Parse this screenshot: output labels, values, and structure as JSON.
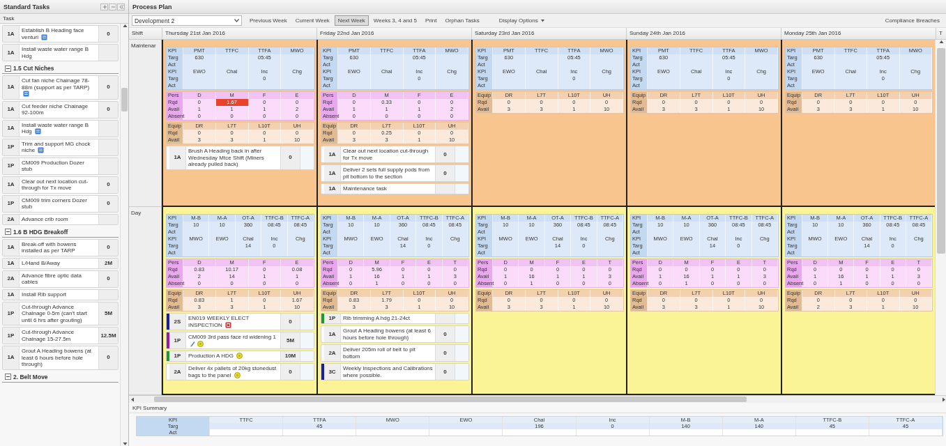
{
  "sidebar": {
    "title": "Standard Tasks",
    "column": "Task",
    "items": [
      {
        "kind": "task",
        "code": "1A",
        "name": "Establish B Heading face venturi",
        "qty": "0",
        "icons": [
          {
            "kind": "note"
          }
        ]
      },
      {
        "kind": "task",
        "code": "1A",
        "name": "Install waste water range B Hdg"
      },
      {
        "kind": "group",
        "title": "1.5 Cut Niches",
        "expanded": true
      },
      {
        "kind": "task",
        "code": "1A",
        "name": "Cut fan niche Chainage 78-88m (support as per TARP)",
        "qty": "0",
        "icons": [
          {
            "kind": "note"
          }
        ]
      },
      {
        "kind": "task",
        "code": "1A",
        "name": "Cut feeder niche Chainage 92-100m",
        "qty": "0"
      },
      {
        "kind": "task",
        "code": "1A",
        "name": "Install waste water range B Hdg",
        "icons": [
          {
            "kind": "note"
          }
        ]
      },
      {
        "kind": "task",
        "code": "1P",
        "name": "Trim and support MG chock niche",
        "icons": [
          {
            "kind": "note"
          }
        ]
      },
      {
        "kind": "task",
        "code": "1P",
        "name": "CM009 Production Dozer stub"
      },
      {
        "kind": "task",
        "code": "1A",
        "name": "Clear out next location cut-through for Tx move",
        "qty": "0"
      },
      {
        "kind": "task",
        "code": "1P",
        "name": "CM009 trim corners Dozer stub",
        "qty": "0"
      },
      {
        "kind": "task",
        "code": "2A",
        "name": "Advance crib room"
      },
      {
        "kind": "group",
        "title": "1.6 B HDG Breakoff",
        "expanded": true
      },
      {
        "kind": "task",
        "code": "1A",
        "name": "Break-off with bowens installed as per TARP",
        "qty": "0"
      },
      {
        "kind": "task",
        "code": "1A",
        "name": "L/Hand B/Away",
        "qty": "2M"
      },
      {
        "kind": "task",
        "code": "2A",
        "name": "Advance fibre optic data cables",
        "qty": "0"
      },
      {
        "kind": "task",
        "code": "1A",
        "name": "Install Rib support"
      },
      {
        "kind": "task",
        "code": "1P",
        "name": "Cut-through Advance Chainage 0-5m (can't start until 6 hrs after grouting)",
        "qty": "5M"
      },
      {
        "kind": "task",
        "code": "1P",
        "name": "Cut-through Advance Chainage 15-27.5m",
        "qty": "12.5M"
      },
      {
        "kind": "task",
        "code": "1A",
        "name": "Grout A Heading bowens (at least 6 hours before hole through)",
        "qty": "0"
      },
      {
        "kind": "group",
        "title": "2. Belt Move",
        "expanded": true
      }
    ]
  },
  "plan": {
    "title": "Process Plan",
    "unit": "Development 2",
    "toolbar": [
      {
        "label": "Previous Week",
        "selected": false
      },
      {
        "label": "Current Week",
        "selected": false
      },
      {
        "label": "Next Week",
        "selected": true
      },
      {
        "label": "Weeks 3, 4 and 5",
        "selected": false
      },
      {
        "label": "Print",
        "selected": false
      },
      {
        "label": "Orphan Tasks",
        "selected": false
      }
    ],
    "display_options": "Display Options",
    "compliance": "Compliance Breaches",
    "shift_header": "Shift",
    "days": [
      "Thursday 21st Jan 2016",
      "Friday 22nd Jan 2016",
      "Saturday 23rd Jan 2016",
      "Sunday 24th Jan 2016",
      "Monday 25th Jan 2016",
      "T"
    ],
    "shifts": [
      {
        "name": "Maintenar",
        "kind": "maintenance",
        "cells": [
          {
            "blocks": [
              {
                "kind": "kpi",
                "rows": [
                  [
                    "KPI",
                    "PMT",
                    "TTFC",
                    "TTFA",
                    "MWO"
                  ],
                  [
                    "Targ",
                    "630",
                    null,
                    "05:45",
                    null
                  ],
                  [
                    "Act",
                    null,
                    null,
                    null,
                    null
                  ],
                  [
                    "KPI",
                    "EWO",
                    "Chal",
                    "Inc",
                    "Chg"
                  ],
                  [
                    "Targ",
                    null,
                    null,
                    "0",
                    null
                  ],
                  [
                    "Act",
                    null,
                    null,
                    null,
                    null
                  ]
                ]
              },
              {
                "kind": "pers",
                "rows": [
                  [
                    "Pers",
                    "D",
                    "M",
                    "F",
                    "E"
                  ],
                  [
                    "Rqd",
                    "0",
                    {
                      "text": "1.67",
                      "breach": true
                    },
                    "0",
                    "0"
                  ],
                  [
                    "Avail",
                    "1",
                    "1",
                    "1",
                    "2"
                  ],
                  [
                    "Absent",
                    "0",
                    "0",
                    "0",
                    "0"
                  ]
                ]
              },
              {
                "kind": "equip",
                "rows": [
                  [
                    "Equip",
                    "DR",
                    "L7T",
                    "L10T",
                    "UH"
                  ],
                  [
                    "Rqd",
                    "0",
                    "0",
                    "0",
                    "0"
                  ],
                  [
                    "Avail",
                    "3",
                    "3",
                    "1",
                    "10"
                  ]
                ]
              }
            ],
            "tasks": [
              {
                "code": "1A",
                "name": "Brush A Heading back in after Wednesday Mtce Shift (Miners already pulled back)",
                "qty": "0"
              }
            ]
          },
          {
            "blocks": [
              {
                "kind": "kpi",
                "rows": [
                  [
                    "KPI",
                    "PMT",
                    "TTFC",
                    "TTFA",
                    "MWO"
                  ],
                  [
                    "Targ",
                    "630",
                    null,
                    "05:45",
                    null
                  ],
                  [
                    "Act",
                    null,
                    null,
                    null,
                    null
                  ],
                  [
                    "KPI",
                    "EWO",
                    "Chal",
                    "Inc",
                    "Chg"
                  ],
                  [
                    "Targ",
                    null,
                    null,
                    "0",
                    null
                  ],
                  [
                    "Act",
                    null,
                    null,
                    null,
                    null
                  ]
                ]
              },
              {
                "kind": "pers",
                "rows": [
                  [
                    "Pers",
                    "D",
                    "M",
                    "F",
                    "E"
                  ],
                  [
                    "Rqd",
                    "0",
                    "0.33",
                    "0",
                    "0"
                  ],
                  [
                    "Avail",
                    "1",
                    "1",
                    "1",
                    "2"
                  ],
                  [
                    "Absent",
                    "0",
                    "0",
                    "0",
                    "0"
                  ]
                ]
              },
              {
                "kind": "equip",
                "rows": [
                  [
                    "Equip",
                    "DR",
                    "L7T",
                    "L10T",
                    "UH"
                  ],
                  [
                    "Rqd",
                    "0",
                    "0.25",
                    "0",
                    "0"
                  ],
                  [
                    "Avail",
                    "3",
                    "3",
                    "1",
                    "10"
                  ]
                ]
              }
            ],
            "tasks": [
              {
                "code": "1A",
                "name": "Clear out next location cut-through for Tx move",
                "qty": "0"
              },
              {
                "code": "1A",
                "name": "Deliver 2 sets full supply pods from pit bottom to the section",
                "qty": "0"
              },
              {
                "code": "1A",
                "name": "Maintenance task"
              }
            ]
          },
          {
            "blocks": [
              {
                "kind": "kpi",
                "rows": [
                  [
                    "KPI",
                    "PMT",
                    "TTFC",
                    "TTFA",
                    "MWO"
                  ],
                  [
                    "Targ",
                    "630",
                    null,
                    "05:45",
                    null
                  ],
                  [
                    "Act",
                    null,
                    null,
                    null,
                    null
                  ],
                  [
                    "KPI",
                    "EWO",
                    "Chal",
                    "Inc",
                    "Chg"
                  ],
                  [
                    "Targ",
                    null,
                    null,
                    "0",
                    null
                  ],
                  [
                    "Act",
                    null,
                    null,
                    null,
                    null
                  ]
                ]
              },
              {
                "kind": "equip",
                "rows": [
                  [
                    "Equip",
                    "DR",
                    "L7T",
                    "L10T",
                    "UH"
                  ],
                  [
                    "Rqd",
                    "0",
                    "0",
                    "0",
                    "0"
                  ],
                  [
                    "Avail",
                    "3",
                    "3",
                    "1",
                    "10"
                  ]
                ]
              }
            ]
          },
          {
            "blocks": [
              {
                "kind": "kpi",
                "rows": [
                  [
                    "KPI",
                    "PMT",
                    "TTFC",
                    "TTFA",
                    "MWO"
                  ],
                  [
                    "Targ",
                    "630",
                    null,
                    "05:45",
                    null
                  ],
                  [
                    "Act",
                    null,
                    null,
                    null,
                    null
                  ],
                  [
                    "KPI",
                    "EWO",
                    "Chal",
                    "Inc",
                    "Chg"
                  ],
                  [
                    "Targ",
                    null,
                    null,
                    "0",
                    null
                  ],
                  [
                    "Act",
                    null,
                    null,
                    null,
                    null
                  ]
                ]
              },
              {
                "kind": "equip",
                "rows": [
                  [
                    "Equip",
                    "DR",
                    "L7T",
                    "L10T",
                    "UH"
                  ],
                  [
                    "Rqd",
                    "0",
                    "0",
                    "0",
                    "0"
                  ],
                  [
                    "Avail",
                    "3",
                    "3",
                    "1",
                    "10"
                  ]
                ]
              }
            ]
          },
          {
            "blocks": [
              {
                "kind": "kpi",
                "rows": [
                  [
                    "KPI",
                    "PMT",
                    "TTFC",
                    "TTFA",
                    "MWO"
                  ],
                  [
                    "Targ",
                    "630",
                    null,
                    "05:45",
                    null
                  ],
                  [
                    "Act",
                    null,
                    null,
                    null,
                    null
                  ],
                  [
                    "KPI",
                    "EWO",
                    "Chal",
                    "Inc",
                    "Chg"
                  ],
                  [
                    "Targ",
                    null,
                    null,
                    "0",
                    null
                  ],
                  [
                    "Act",
                    null,
                    null,
                    null,
                    null
                  ]
                ]
              },
              {
                "kind": "equip",
                "rows": [
                  [
                    "Equip",
                    "DR",
                    "L7T",
                    "L10T",
                    "UH"
                  ],
                  [
                    "Rqd",
                    "0",
                    "0",
                    "0",
                    "0"
                  ],
                  [
                    "Avail",
                    "3",
                    "3",
                    "1",
                    "10"
                  ]
                ]
              }
            ]
          }
        ]
      },
      {
        "name": "Day",
        "kind": "day",
        "cells": [
          {
            "blocks": [
              {
                "kind": "kpi",
                "rows": [
                  [
                    "KPI",
                    "M-B",
                    "M-A",
                    "OT-A",
                    "TTFC-B",
                    "TTFC-A"
                  ],
                  [
                    "Targ",
                    "10",
                    "10",
                    "360",
                    "08:45",
                    "08:45"
                  ],
                  [
                    "Act",
                    null,
                    null,
                    null,
                    null,
                    null
                  ],
                  [
                    "KPI",
                    "MWO",
                    "EWO",
                    "Chal",
                    "Inc",
                    "Chg"
                  ],
                  [
                    "Targ",
                    null,
                    null,
                    "14",
                    "0",
                    null
                  ],
                  [
                    "Act",
                    null,
                    null,
                    null,
                    null,
                    null
                  ]
                ]
              },
              {
                "kind": "pers",
                "rows": [
                  [
                    "Pers",
                    "D",
                    "M",
                    "F",
                    "E"
                  ],
                  [
                    "Rqd",
                    "0.83",
                    "10.17",
                    "0",
                    "0.08"
                  ],
                  [
                    "Avail",
                    "2",
                    "14",
                    "1",
                    "1"
                  ],
                  [
                    "Absent",
                    "0",
                    "0",
                    "0",
                    "0"
                  ]
                ]
              },
              {
                "kind": "equip",
                "rows": [
                  [
                    "Equip",
                    "DR",
                    "L7T",
                    "L10T",
                    "UH"
                  ],
                  [
                    "Rqd",
                    "0.83",
                    "1",
                    "0",
                    "1.67"
                  ],
                  [
                    "Avail",
                    "3",
                    "3",
                    "1",
                    "10"
                  ]
                ]
              }
            ],
            "tasks": [
              {
                "code": "2S",
                "name": "EN019 WEEKLY ELECT INSPECTION",
                "qty": "0",
                "color": "#1c1c9e",
                "icons": [
                  {
                    "kind": "alert"
                  }
                ]
              },
              {
                "code": "1P",
                "name": "CM009 3rd pass face rd widening",
                "qty": "5M",
                "color": "#9a1a9c",
                "attachments": "1",
                "icons": [
                  {
                    "kind": "attachment"
                  },
                  {
                    "kind": "pending"
                  }
                ]
              },
              {
                "code": "1P",
                "name": "Production A HDG",
                "qty": "10M",
                "color": "#1f9a2a",
                "icons": [
                  {
                    "kind": "pending"
                  }
                ]
              },
              {
                "code": "2A",
                "name": "Deliver 4x pallets of 20kg stonedust bags to the panel",
                "qty": "0",
                "icons": [
                  {
                    "kind": "pending"
                  }
                ]
              }
            ]
          },
          {
            "blocks": [
              {
                "kind": "kpi",
                "rows": [
                  [
                    "KPI",
                    "M-B",
                    "M-A",
                    "OT-A",
                    "TTFC-B",
                    "TTFC-A"
                  ],
                  [
                    "Targ",
                    "10",
                    "10",
                    "360",
                    "08:45",
                    "08:45"
                  ],
                  [
                    "Act",
                    null,
                    null,
                    null,
                    null,
                    null
                  ],
                  [
                    "KPI",
                    "MWO",
                    "EWO",
                    "Chal",
                    "Inc",
                    "Chg"
                  ],
                  [
                    "Targ",
                    null,
                    null,
                    "14",
                    "0",
                    null
                  ],
                  [
                    "Act",
                    null,
                    null,
                    null,
                    null,
                    null
                  ]
                ]
              },
              {
                "kind": "pers",
                "rows": [
                  [
                    "Pers",
                    "D",
                    "M",
                    "F",
                    "E",
                    "T"
                  ],
                  [
                    "Rqd",
                    "0",
                    "5.96",
                    "0",
                    "0",
                    "0"
                  ],
                  [
                    "Avail",
                    "1",
                    "16",
                    "1",
                    "1",
                    "3"
                  ],
                  [
                    "Absent",
                    "0",
                    "1",
                    "0",
                    "0",
                    "0"
                  ]
                ]
              },
              {
                "kind": "equip",
                "rows": [
                  [
                    "Equip",
                    "DR",
                    "L7T",
                    "L10T",
                    "UH"
                  ],
                  [
                    "Rqd",
                    "0.83",
                    "1.79",
                    "0",
                    "0"
                  ],
                  [
                    "Avail",
                    "3",
                    "3",
                    "1",
                    "10"
                  ]
                ]
              }
            ],
            "tasks": [
              {
                "code": "1P",
                "name": "Rib trimming A hdg 21-24ct",
                "color": "#1f9a2a"
              },
              {
                "code": "1A",
                "name": "Grout A Heading bowens (at least 6 hours before hole through)",
                "qty": "0"
              },
              {
                "code": "2A",
                "name": "Deliver 205m roll of belt to pit bottom",
                "qty": "0"
              },
              {
                "code": "3C",
                "name": "Weekly Inspections and Calibrations where possible.",
                "qty": "0",
                "color": "#1c1c9e"
              }
            ]
          },
          {
            "blocks": [
              {
                "kind": "kpi",
                "rows": [
                  [
                    "KPI",
                    "M-B",
                    "M-A",
                    "OT-A",
                    "TTFC-B",
                    "TTFC-A"
                  ],
                  [
                    "Targ",
                    "10",
                    "10",
                    "360",
                    "08:45",
                    "08:45"
                  ],
                  [
                    "Act",
                    null,
                    null,
                    null,
                    null,
                    null
                  ],
                  [
                    "KPI",
                    "MWO",
                    "EWO",
                    "Chal",
                    "Inc",
                    "Chg"
                  ],
                  [
                    "Targ",
                    null,
                    null,
                    "14",
                    "0",
                    null
                  ],
                  [
                    "Act",
                    null,
                    null,
                    null,
                    null,
                    null
                  ]
                ]
              },
              {
                "kind": "pers",
                "rows": [
                  [
                    "Pers",
                    "D",
                    "M",
                    "F",
                    "E",
                    "T"
                  ],
                  [
                    "Rqd",
                    "0",
                    "0",
                    "0",
                    "0",
                    "0"
                  ],
                  [
                    "Avail",
                    "1",
                    "16",
                    "1",
                    "1",
                    "3"
                  ],
                  [
                    "Absent",
                    "0",
                    "1",
                    "0",
                    "0",
                    "0"
                  ]
                ]
              },
              {
                "kind": "equip",
                "rows": [
                  [
                    "Equip",
                    "DR",
                    "L7T",
                    "L10T",
                    "UH"
                  ],
                  [
                    "Rqd",
                    "0",
                    "0",
                    "0",
                    "0"
                  ],
                  [
                    "Avail",
                    "3",
                    "3",
                    "1",
                    "10"
                  ]
                ]
              }
            ]
          },
          {
            "blocks": [
              {
                "kind": "kpi",
                "rows": [
                  [
                    "KPI",
                    "M-B",
                    "M-A",
                    "OT-A",
                    "TTFC-B",
                    "TTFC-A"
                  ],
                  [
                    "Targ",
                    "10",
                    "10",
                    "360",
                    "08:45",
                    "08:45"
                  ],
                  [
                    "Act",
                    null,
                    null,
                    null,
                    null,
                    null
                  ],
                  [
                    "KPI",
                    "MWO",
                    "EWO",
                    "Chal",
                    "Inc",
                    "Chg"
                  ],
                  [
                    "Targ",
                    null,
                    null,
                    "14",
                    "0",
                    null
                  ],
                  [
                    "Act",
                    null,
                    null,
                    null,
                    null,
                    null
                  ]
                ]
              },
              {
                "kind": "pers",
                "rows": [
                  [
                    "Pers",
                    "D",
                    "M",
                    "F",
                    "E",
                    "T"
                  ],
                  [
                    "Rqd",
                    "0",
                    "0",
                    "0",
                    "0",
                    "0"
                  ],
                  [
                    "Avail",
                    "1",
                    "16",
                    "1",
                    "1",
                    "3"
                  ],
                  [
                    "Absent",
                    "0",
                    "1",
                    "0",
                    "0",
                    "0"
                  ]
                ]
              },
              {
                "kind": "equip",
                "rows": [
                  [
                    "Equip",
                    "DR",
                    "L7T",
                    "L10T",
                    "UH"
                  ],
                  [
                    "Rqd",
                    "0",
                    "0",
                    "0",
                    "0"
                  ],
                  [
                    "Avail",
                    "3",
                    "3",
                    "1",
                    "10"
                  ]
                ]
              }
            ]
          },
          {
            "blocks": [
              {
                "kind": "kpi",
                "rows": [
                  [
                    "KPI",
                    "M-B",
                    "M-A",
                    "OT-A",
                    "TTFC-B",
                    "TTFC-A"
                  ],
                  [
                    "Targ",
                    "10",
                    "10",
                    "360",
                    "08:45",
                    "08:45"
                  ],
                  [
                    "Act",
                    null,
                    null,
                    null,
                    null,
                    null
                  ],
                  [
                    "KPI",
                    "MWO",
                    "EWO",
                    "Chal",
                    "Inc",
                    "Chg"
                  ],
                  [
                    "Targ",
                    null,
                    null,
                    "14",
                    "0",
                    null
                  ],
                  [
                    "Act",
                    null,
                    null,
                    null,
                    null,
                    null
                  ]
                ]
              },
              {
                "kind": "pers",
                "rows": [
                  [
                    "Pers",
                    "D",
                    "M",
                    "F",
                    "E",
                    "T"
                  ],
                  [
                    "Rqd",
                    "0",
                    "0",
                    "0",
                    "0",
                    "0"
                  ],
                  [
                    "Avail",
                    "1",
                    "16",
                    "1",
                    "1",
                    "3"
                  ],
                  [
                    "Absent",
                    "0",
                    "1",
                    "0",
                    "0",
                    "0"
                  ]
                ]
              },
              {
                "kind": "equip",
                "rows": [
                  [
                    "Equip",
                    "DR",
                    "L7T",
                    "L10T",
                    "UH"
                  ],
                  [
                    "Rqd",
                    "0",
                    "0",
                    "0",
                    "0"
                  ],
                  [
                    "Avail",
                    "2",
                    "3",
                    "1",
                    "10"
                  ]
                ]
              }
            ]
          }
        ]
      }
    ]
  },
  "kpi_summary": {
    "title": "KPI Summary",
    "columns": [
      "KPI",
      "TTFC",
      "TTFA",
      "MWO",
      "EWO",
      "Chal",
      "Inc",
      "M-B",
      "M-A",
      "TTFC-B",
      "TTFC-A"
    ],
    "rows": [
      [
        "Targ",
        null,
        "45",
        null,
        null,
        "196",
        "0",
        "140",
        "140",
        "45",
        "45"
      ],
      [
        "Act",
        null,
        null,
        null,
        null,
        null,
        null,
        null,
        null,
        null,
        null
      ]
    ]
  }
}
